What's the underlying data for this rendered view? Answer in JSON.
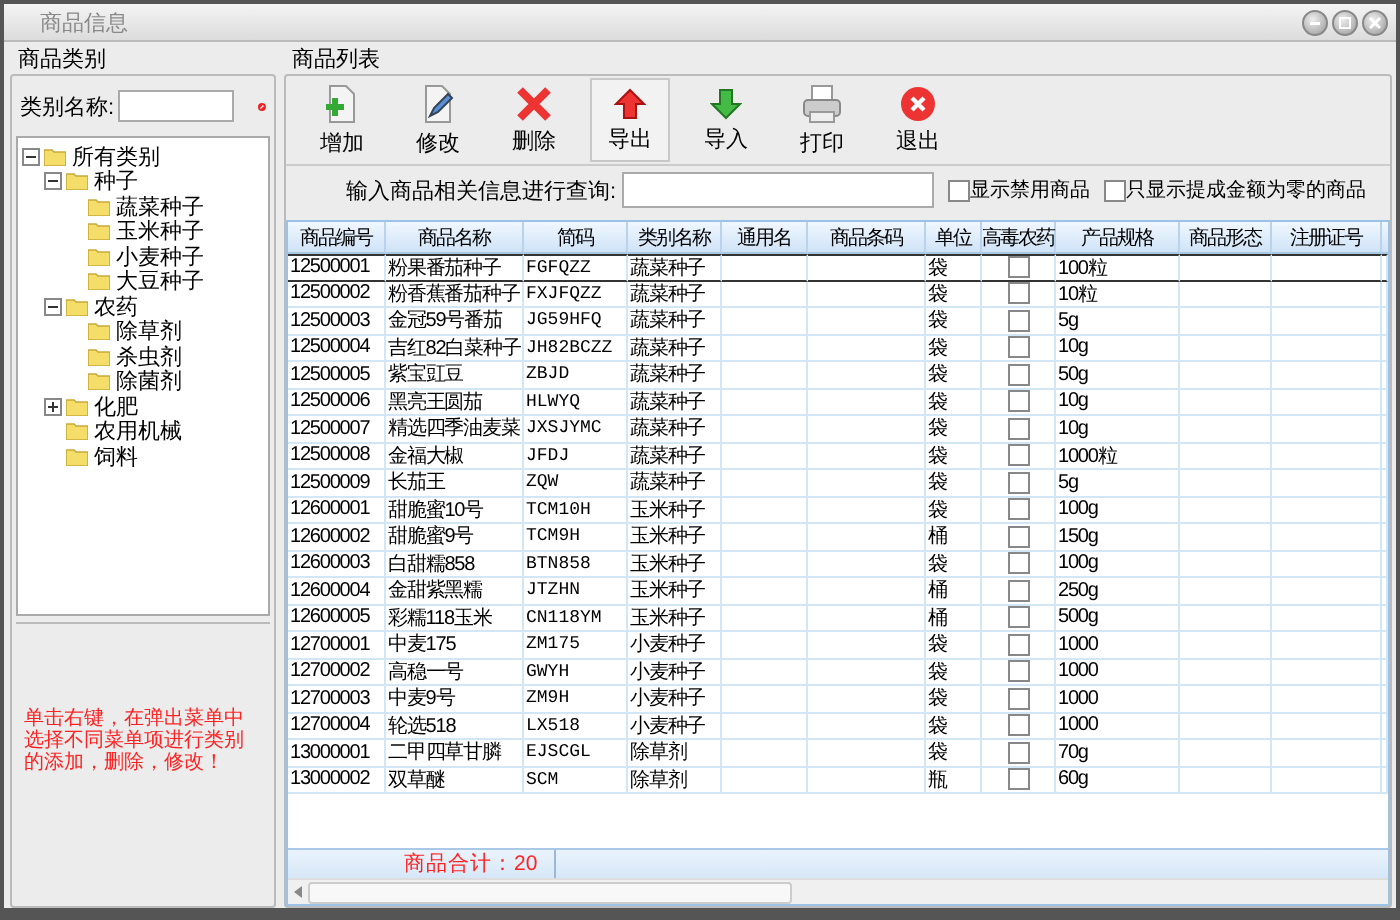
{
  "window": {
    "title": "商品信息"
  },
  "category_panel": {
    "title": "商品类别",
    "search_label": "类别名称:",
    "tree": [
      {
        "label": "所有类别",
        "expanded": true,
        "children": [
          {
            "label": "种子",
            "expanded": true,
            "children": [
              {
                "label": "蔬菜种子"
              },
              {
                "label": "玉米种子"
              },
              {
                "label": "小麦种子"
              },
              {
                "label": "大豆种子"
              }
            ]
          },
          {
            "label": "农药",
            "expanded": true,
            "children": [
              {
                "label": "除草剂"
              },
              {
                "label": "杀虫剂"
              },
              {
                "label": "除菌剂"
              }
            ]
          },
          {
            "label": "化肥",
            "expanded": false
          },
          {
            "label": "农用机械"
          },
          {
            "label": "饲料"
          }
        ]
      }
    ],
    "hint": "单击右键，在弹出菜单中选择不同菜单项进行类别的添加，删除，修改！"
  },
  "product_panel": {
    "title": "商品列表",
    "toolbar": [
      {
        "label": "增加",
        "kind": "add",
        "pressed": false
      },
      {
        "label": "修改",
        "kind": "edit",
        "pressed": false
      },
      {
        "label": "删除",
        "kind": "delete",
        "pressed": false
      },
      {
        "label": "导出",
        "kind": "export",
        "pressed": true
      },
      {
        "label": "导入",
        "kind": "import",
        "pressed": false
      },
      {
        "label": "打印",
        "kind": "print",
        "pressed": false
      },
      {
        "label": "退出",
        "kind": "exit",
        "pressed": false
      }
    ],
    "search_label": "输入商品相关信息进行查询:",
    "filters": [
      {
        "label": "显示禁用商品",
        "checked": false
      },
      {
        "label": "只显示提成金额为零的商品",
        "checked": false
      }
    ],
    "columns": [
      "商品编号",
      "商品名称",
      "简码",
      "类别名称",
      "通用名",
      "商品条码",
      "单位",
      "高毒农药",
      "产品规格",
      "商品形态",
      "注册证号"
    ],
    "rows": [
      {
        "code": "12500001",
        "name": "粉果番茄种子",
        "abbr": "FGFQZZ",
        "category": "蔬菜种子",
        "unit": "袋",
        "toxic": false,
        "spec": "100粒",
        "selected": true
      },
      {
        "code": "12500002",
        "name": "粉香蕉番茄种子",
        "abbr": "FXJFQZZ",
        "category": "蔬菜种子",
        "unit": "袋",
        "toxic": false,
        "spec": "10粒",
        "selected": false
      },
      {
        "code": "12500003",
        "name": "金冠59号番茄",
        "abbr": "JG59HFQ",
        "category": "蔬菜种子",
        "unit": "袋",
        "toxic": false,
        "spec": "5g",
        "selected": false
      },
      {
        "code": "12500004",
        "name": "吉红82白菜种子",
        "abbr": "JH82BCZZ",
        "category": "蔬菜种子",
        "unit": "袋",
        "toxic": false,
        "spec": "10g",
        "selected": false
      },
      {
        "code": "12500005",
        "name": "紫宝豇豆",
        "abbr": "ZBJD",
        "category": "蔬菜种子",
        "unit": "袋",
        "toxic": false,
        "spec": "50g",
        "selected": false
      },
      {
        "code": "12500006",
        "name": "黑亮王圆茄",
        "abbr": "HLWYQ",
        "category": "蔬菜种子",
        "unit": "袋",
        "toxic": false,
        "spec": "10g",
        "selected": false
      },
      {
        "code": "12500007",
        "name": "精选四季油麦菜",
        "abbr": "JXSJYMC",
        "category": "蔬菜种子",
        "unit": "袋",
        "toxic": false,
        "spec": "10g",
        "selected": false
      },
      {
        "code": "12500008",
        "name": "金福大椒",
        "abbr": "JFDJ",
        "category": "蔬菜种子",
        "unit": "袋",
        "toxic": false,
        "spec": "1000粒",
        "selected": false
      },
      {
        "code": "12500009",
        "name": "长茄王",
        "abbr": "ZQW",
        "category": "蔬菜种子",
        "unit": "袋",
        "toxic": false,
        "spec": "5g",
        "selected": false
      },
      {
        "code": "12600001",
        "name": "甜脆蜜10号",
        "abbr": "TCM10H",
        "category": "玉米种子",
        "unit": "袋",
        "toxic": false,
        "spec": "100g",
        "selected": false
      },
      {
        "code": "12600002",
        "name": "甜脆蜜9号",
        "abbr": "TCM9H",
        "category": "玉米种子",
        "unit": "桶",
        "toxic": false,
        "spec": "150g",
        "selected": false
      },
      {
        "code": "12600003",
        "name": "白甜糯858",
        "abbr": "BTN858",
        "category": "玉米种子",
        "unit": "袋",
        "toxic": false,
        "spec": "100g",
        "selected": false
      },
      {
        "code": "12600004",
        "name": "金甜紫黑糯",
        "abbr": "JTZHN",
        "category": "玉米种子",
        "unit": "桶",
        "toxic": false,
        "spec": "250g",
        "selected": false
      },
      {
        "code": "12600005",
        "name": "彩糯118玉米",
        "abbr": "CN118YM",
        "category": "玉米种子",
        "unit": "桶",
        "toxic": false,
        "spec": "500g",
        "selected": false
      },
      {
        "code": "12700001",
        "name": "中麦175",
        "abbr": "ZM175",
        "category": "小麦种子",
        "unit": "袋",
        "toxic": false,
        "spec": "1000",
        "selected": false
      },
      {
        "code": "12700002",
        "name": "高稳一号",
        "abbr": "GWYH",
        "category": "小麦种子",
        "unit": "袋",
        "toxic": false,
        "spec": "1000",
        "selected": false
      },
      {
        "code": "12700003",
        "name": "中麦9号",
        "abbr": "ZM9H",
        "category": "小麦种子",
        "unit": "袋",
        "toxic": false,
        "spec": "1000",
        "selected": false
      },
      {
        "code": "12700004",
        "name": "轮选518",
        "abbr": "LX518",
        "category": "小麦种子",
        "unit": "袋",
        "toxic": false,
        "spec": "1000",
        "selected": false
      },
      {
        "code": "13000001",
        "name": "二甲四草甘膦",
        "abbr": "EJSCGL",
        "category": "除草剂",
        "unit": "袋",
        "toxic": false,
        "spec": "70g",
        "selected": false
      },
      {
        "code": "13000002",
        "name": "双草醚",
        "abbr": "SCM",
        "category": "除草剂",
        "unit": "瓶",
        "toxic": false,
        "spec": "60g",
        "selected": false
      }
    ],
    "total": "商品合计：20"
  }
}
